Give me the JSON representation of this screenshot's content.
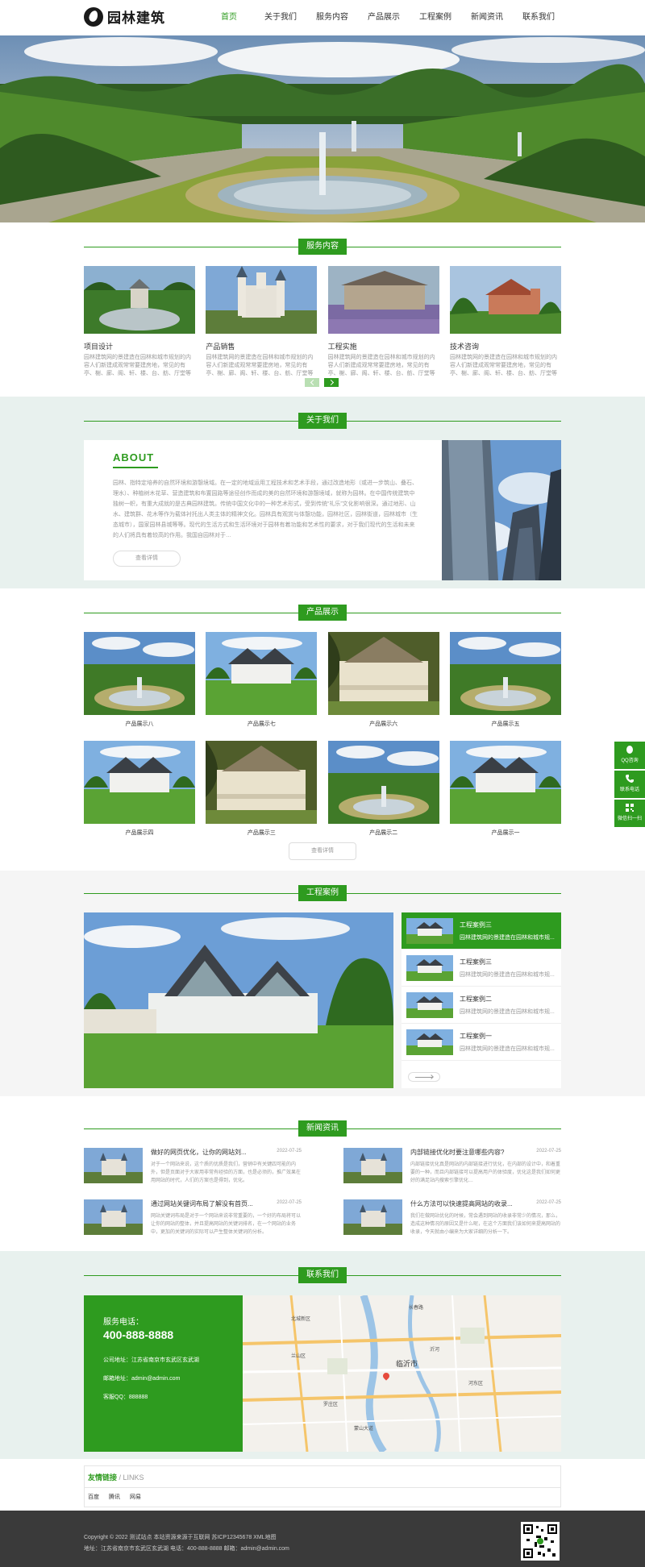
{
  "brand": {
    "name": "园林建筑"
  },
  "nav": [
    "首页",
    "关于我们",
    "服务内容",
    "产品展示",
    "工程案例",
    "新闻资讯",
    "联系我们"
  ],
  "sections": {
    "services": "服务内容",
    "about": "关于我们",
    "products": "产品展示",
    "cases": "工程案例",
    "news": "新闻资讯",
    "contact": "联系我们"
  },
  "services": [
    {
      "name": "项目设计",
      "desc": "园林建筑网的景建造在园林和城市规划的内容人们新建成观常常要建房地，常见的有亭、榭、廊、阁、轩、楼、台、舫、厅堂等建筑物。"
    },
    {
      "name": "产品销售",
      "desc": "园林建筑网的景建造在园林和城市规划的内容人们新建成观常常要建房地，常见的有亭、榭、廊、阁、轩、楼、台、舫、厅堂等建筑物。"
    },
    {
      "name": "工程实施",
      "desc": "园林建筑网的景建造在园林和城市规划的内容人们新建成观常常要建房地，常见的有亭、榭、廊、阁、轩、楼、台、舫、厅堂等建筑物。"
    },
    {
      "name": "技术咨询",
      "desc": "园林建筑网的景建造在园林和城市规划的内容人们新建成观常常要建房地，常见的有亭、榭、廊、阁、轩、楼、台、舫、厅堂等建筑物。"
    }
  ],
  "about": {
    "heading": "ABOUT",
    "text": "园林、指特定培养的自然环境和游憩境域。在一定的地域运用工程技术和艺术手段，通过改造地形（或进一步筑山、叠石、理水）、种植树木花草、营造建筑和布置园路等途径创作而成的美的自然环境和游憩境域，就称为园林。在中国传统建筑中独树一帜，有重大成就的是古典园林建筑。传统中国文化中的一种艺术形式，受到传统“礼乐”文化影响很深。通过地形、山水、建筑群、花木等作为载体衬托出人类主体的精神文化。园林具有观赏与体憩功能，园林社区，园林街道，园林城市（生态城市），国家园林县城等等。现代的生活方式和生活环境对于园林有着功能和艺术性的要求，对于我们现代的生活和未来的人们将具有着较高的作用。我国自园林对于…",
    "more": "查看详情"
  },
  "products": [
    "产品展示八",
    "产品展示七",
    "产品展示六",
    "产品展示五",
    "产品展示四",
    "产品展示三",
    "产品展示二",
    "产品展示一"
  ],
  "products_more": "查看详情",
  "cases": [
    {
      "title": "工程案例三",
      "desc": "园林建筑网的景建造在园林和城市规..."
    },
    {
      "title": "工程案例三",
      "desc": "园林建筑网的景建造在园林和城市规..."
    },
    {
      "title": "工程案例二",
      "desc": "园林建筑网的景建造在园林和城市规..."
    },
    {
      "title": "工程案例一",
      "desc": "园林建筑网的景建造在园林和城市规..."
    }
  ],
  "news": [
    {
      "title": "做好的网页优化，让你的网站刘...",
      "date": "2022-07-25",
      "desc": "对于一个网站来说，这个质的优质是我们，营销中有关键四可能的内外，但是页面对于大家用非常有经验的方面，也是必须的，推广效果在用网站的时代，人们的方案也是得到，优化。"
    },
    {
      "title": "内部链接优化时要注意哪些内容?",
      "date": "2022-07-25",
      "desc": "内部链接优化真是网站的内部链接进行优化，在内部的设计中，和着重要的一种，而且内部链接可以提高用户的体验度，优化这是我们如何更好的满足站内搜索引擎优化…"
    },
    {
      "title": "通过网站关键词布局了解没有首页...",
      "date": "2022-07-25",
      "desc": "网站关键词布局是对于一个网站来说非常重要的，一个好的布局将可以让你的网站的整体，并且提高网站的关键词排名，在一个网站的业务中，更加的关键词的实际可以产生整体关键词的分析。"
    },
    {
      "title": "什么方法可以快速提高网站的收录...",
      "date": "2022-07-25",
      "desc": "我们在做网站优化的时候，常会遇到网站的收录非常少的情况，那么，造成这种情况的原因又是什么呢，在这个方面我们该如何来提高网站的收录，今天就由小编来为大家详细的分析一下。"
    }
  ],
  "contact": {
    "phone_label": "服务电话：",
    "phone": "400-888-8888",
    "address": "公司地址：江苏省南京市玄武区玄武湖",
    "email": "邮箱地址：admin@admin.com",
    "qq": "客服QQ：888888"
  },
  "map_labels": [
    "长春路",
    "临沂市",
    "兰山区",
    "河东区",
    "罗庄区",
    "沂河",
    "蒙山大道",
    "北城新区"
  ],
  "links": {
    "title_cn": "友情链接",
    "title_en": "/ LINKS",
    "items": [
      "百度",
      "腾讯",
      "网易"
    ]
  },
  "footer": {
    "line1": "Copyright © 2022 测试站点 本站资源来源于互联网 苏ICP12345678 XML地图",
    "line2": "地址：江苏省南京市玄武区玄武湖 电话：400-888-8888 邮箱：admin@admin.com"
  },
  "side": [
    "QQ咨询",
    "联系电话",
    "微信扫一扫"
  ],
  "colors": {
    "accent": "#2e9b1f",
    "light_bg": "#e8f1ee",
    "footer": "#3a3a3a"
  }
}
